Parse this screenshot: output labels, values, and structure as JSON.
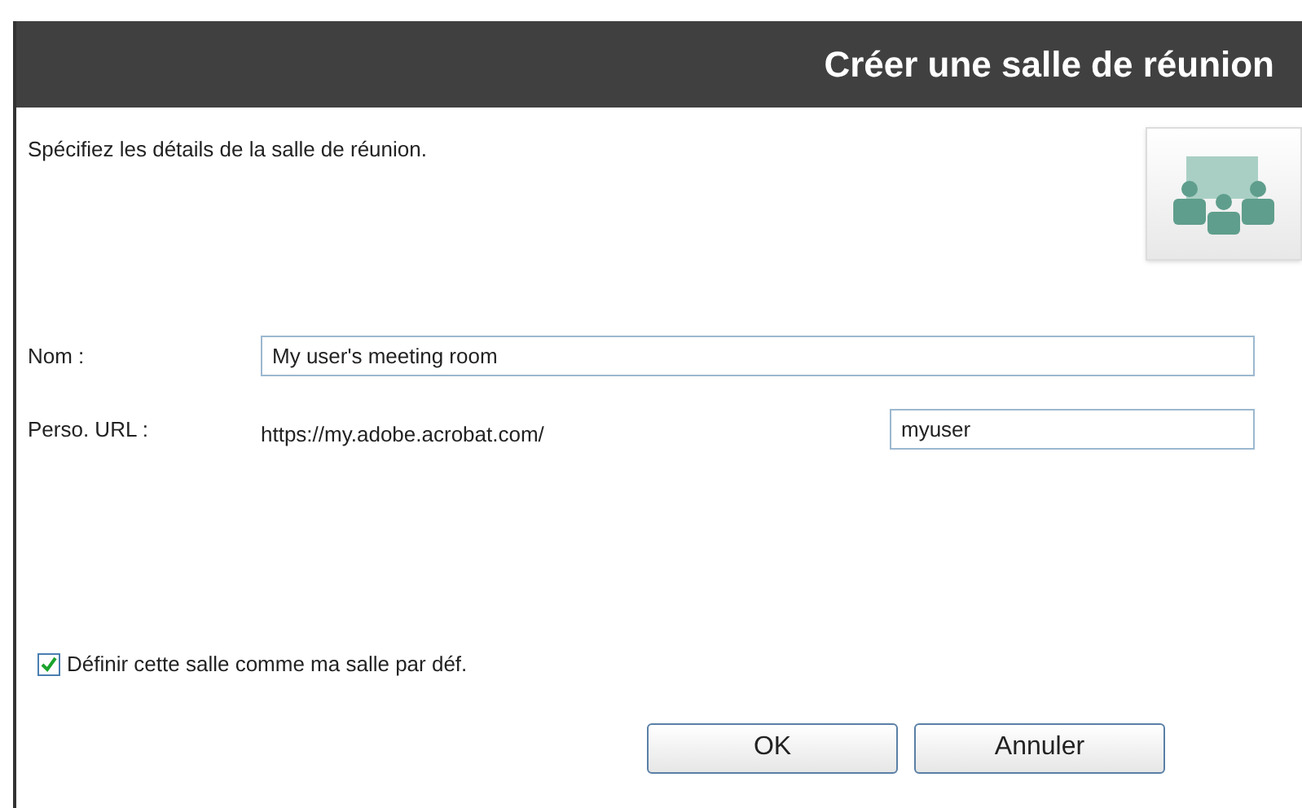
{
  "dialog": {
    "title": "Créer une salle de réunion",
    "description": "Spécifiez les détails de la salle de réunion.",
    "fields": [
      {
        "label": "Nom :",
        "value": "My user's meeting room"
      },
      {
        "label": "Perso. URL :",
        "prefix": "https://my.adobe.acrobat.com/",
        "value": "myuser"
      }
    ],
    "default_room": {
      "label": "Définir cette salle comme ma salle par déf.",
      "checked": true
    },
    "buttons": [
      "OK",
      "Annuler"
    ]
  }
}
